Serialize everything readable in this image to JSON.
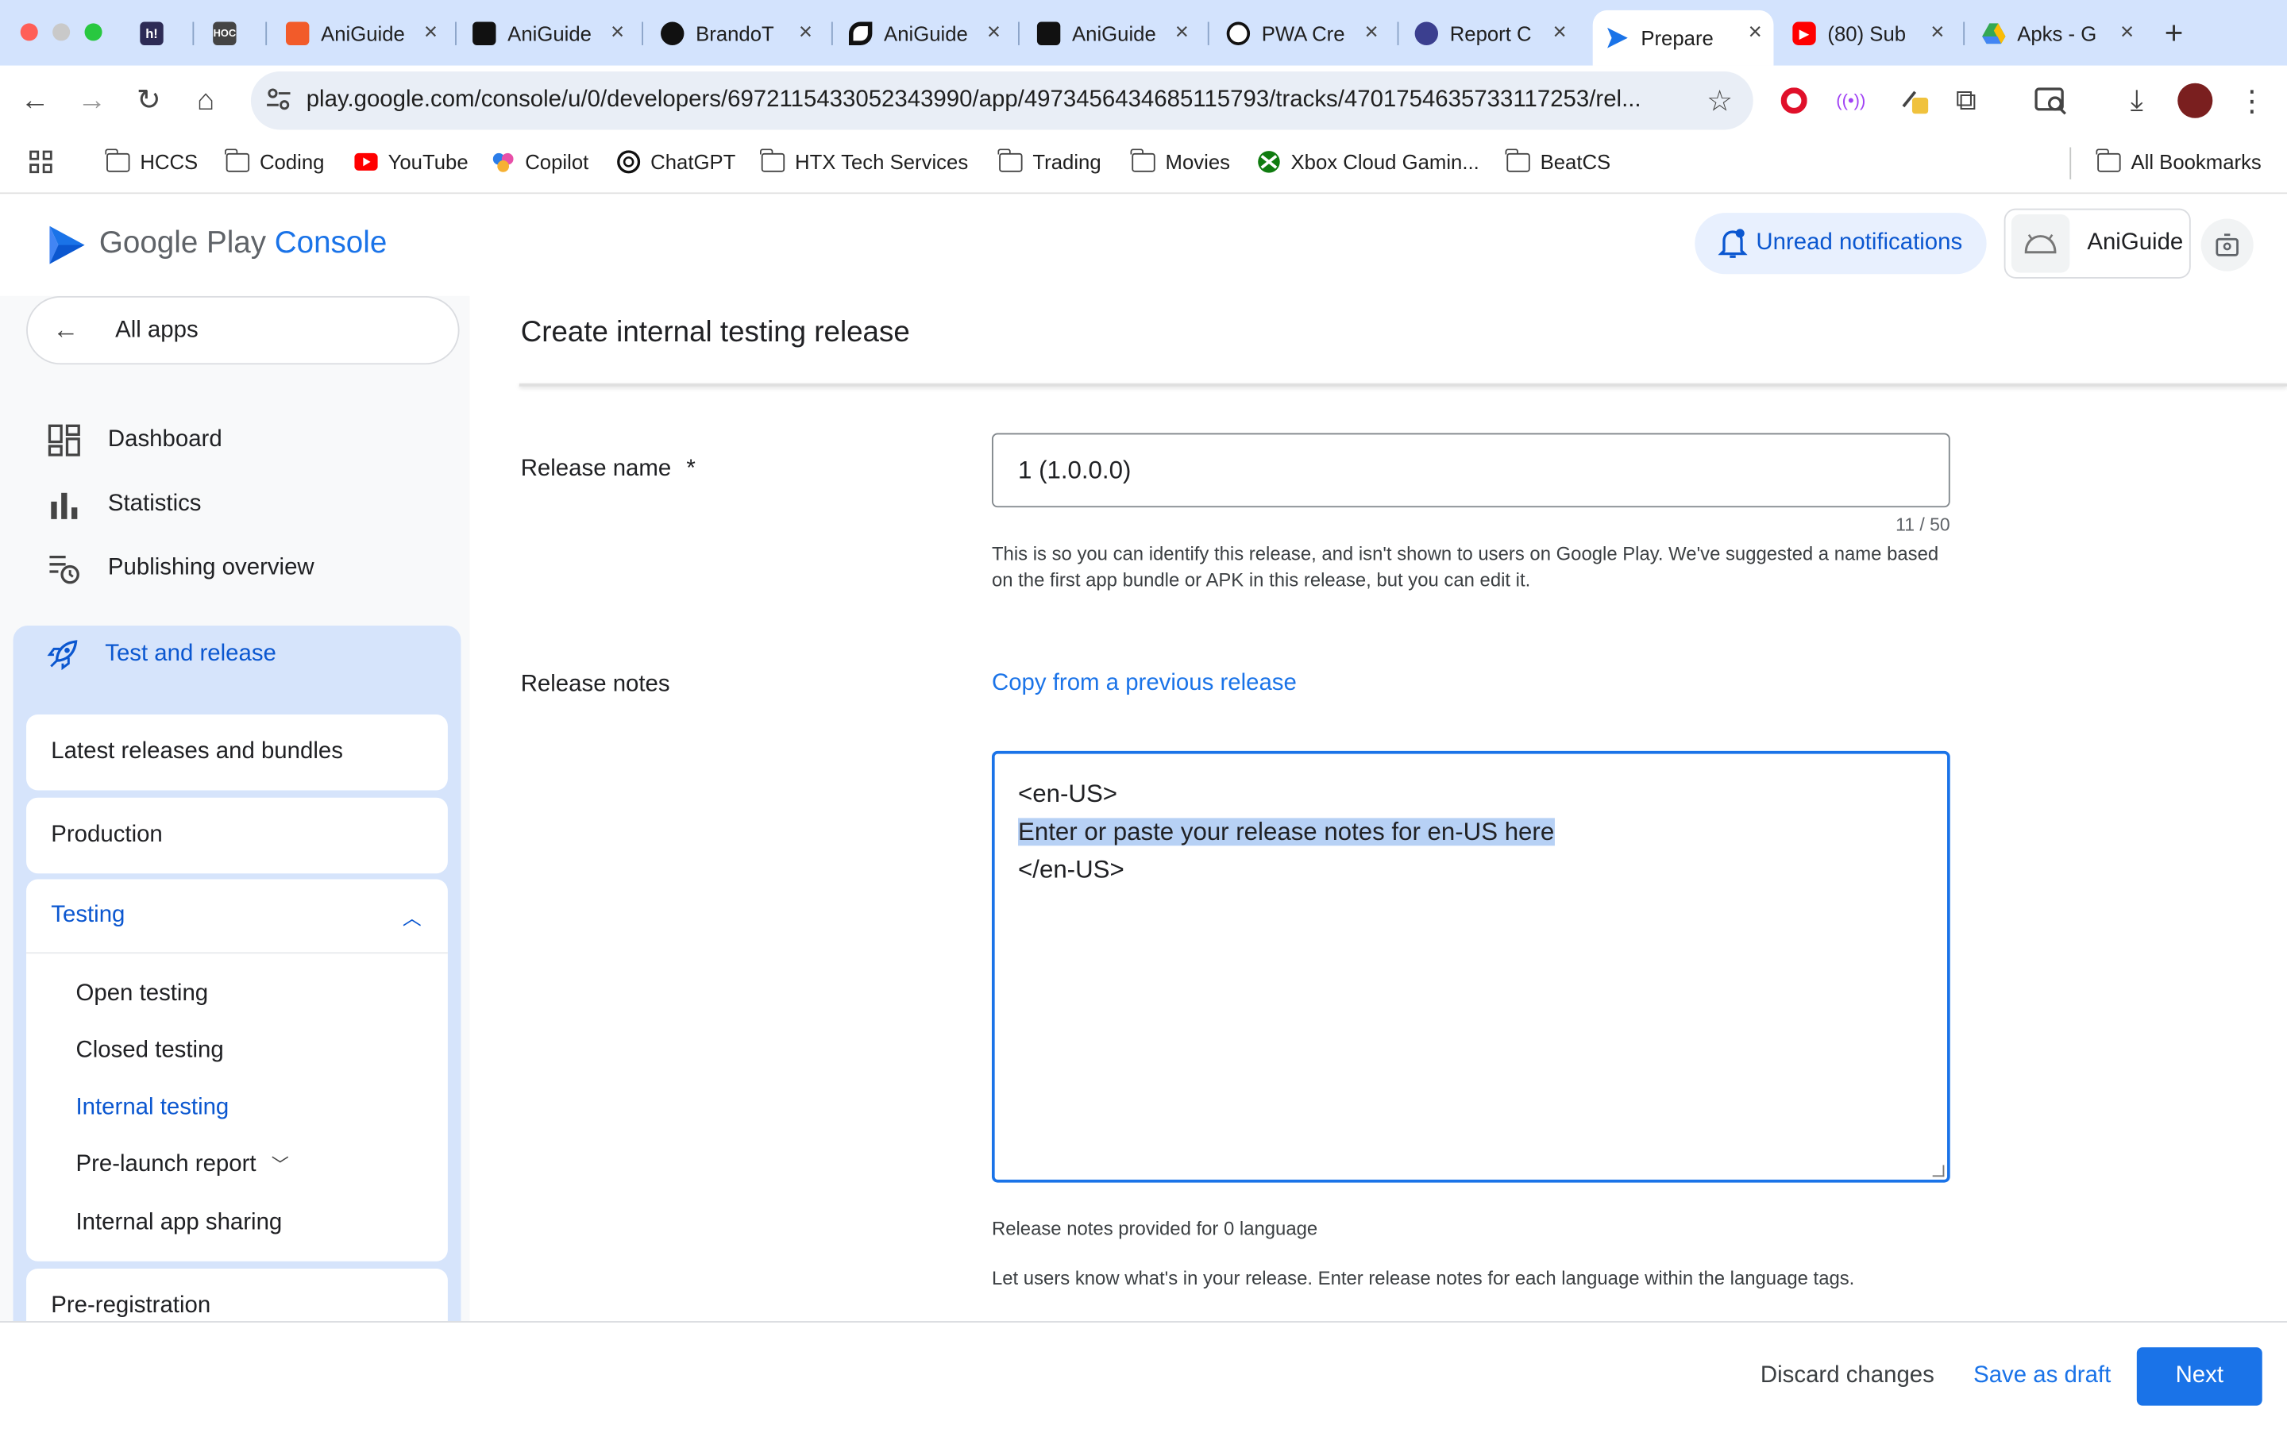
{
  "browser": {
    "tabs": [
      {
        "title": "",
        "icon": "hashnode-icon",
        "color": "#2d2b55"
      },
      {
        "title": "",
        "icon": "hoc-icon",
        "color": "#333333"
      },
      {
        "title": "AniGuide",
        "icon": "aniguide-orange-icon",
        "color": "#f25b2a"
      },
      {
        "title": "AniGuide",
        "icon": "aniguide-guide-icon",
        "color": "#111111"
      },
      {
        "title": "BrandoT",
        "icon": "github-icon",
        "color": "#111111"
      },
      {
        "title": "AniGuide",
        "icon": "aniguide-ink-icon",
        "color": "#111111"
      },
      {
        "title": "AniGuide",
        "icon": "aniguide-guide-icon",
        "color": "#111111"
      },
      {
        "title": "PWA Cre",
        "icon": "openai-icon",
        "color": "#111111"
      },
      {
        "title": "Report C",
        "icon": "report-icon",
        "color": "#3b3f8f"
      },
      {
        "title": "Prepare",
        "icon": "google-play-console-icon",
        "color": "#1a73e8"
      },
      {
        "title": "(80) Sub",
        "icon": "youtube-icon",
        "color": "#ff0000"
      },
      {
        "title": "Apks - G",
        "icon": "google-drive-icon",
        "color": "#34a853"
      }
    ],
    "url": "play.google.com/console/u/0/developers/6972115433052343990/app/4973456434685115793/tracks/4701754635733117253/rel...",
    "bookmarks": [
      "HCCS",
      "Coding",
      "YouTube",
      "Copilot",
      "ChatGPT",
      "HTX Tech Services",
      "Trading",
      "Movies",
      "Xbox Cloud Gamin...",
      "BeatCS"
    ],
    "all_bookmarks": "All Bookmarks"
  },
  "header": {
    "brand_google_play": "Google Play",
    "brand_console": "Console",
    "notifications_label": "Unread notifications",
    "app_name": "AniGuide"
  },
  "sidebar": {
    "all_apps": "All apps",
    "items": [
      "Dashboard",
      "Statistics",
      "Publishing overview"
    ],
    "section": "Test and release",
    "cards": [
      "Latest releases and bundles",
      "Production"
    ],
    "testing": {
      "title": "Testing",
      "items": [
        "Open testing",
        "Closed testing",
        "Internal testing",
        "Pre-launch report",
        "Internal app sharing"
      ]
    },
    "pre_registration": "Pre-registration"
  },
  "main": {
    "title": "Create internal testing release",
    "release_name_label": "Release name",
    "required_mark": "*",
    "release_name_value": "1 (1.0.0.0)",
    "counter": "11 / 50",
    "helper": "This is so you can identify this release, and isn't shown to users on Google Play. We've suggested a name based on the first app bundle or APK in this release, but you can edit it.",
    "release_notes_label": "Release notes",
    "copy_link": "Copy from a previous release",
    "notes_open_tag": "<en-US>",
    "notes_placeholder": "Enter or paste your release notes for en-US here",
    "notes_close_tag": "</en-US>",
    "notes_count": "Release notes provided for 0 language",
    "notes_help": "Let users know what's in your release. Enter release notes for each language within the language tags."
  },
  "footer": {
    "discard": "Discard changes",
    "save_draft": "Save as draft",
    "next": "Next"
  },
  "colors": {
    "accent": "#1a73e8",
    "nav_section_bg": "#d6e4fb",
    "tabstrip_bg": "#d3e3fd",
    "selection": "#b7d1f5"
  }
}
